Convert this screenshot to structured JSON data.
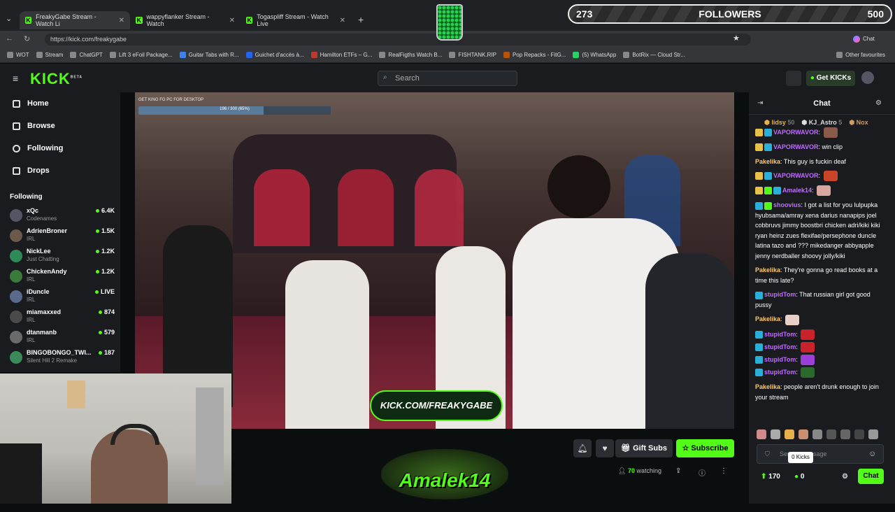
{
  "browser": {
    "tabs": [
      {
        "label": "FreakyGabe Stream - Watch Li"
      },
      {
        "label": "wappyflanker Stream - Watch"
      },
      {
        "label": "Togaspliff Stream - Watch Live"
      }
    ],
    "url": "https://kick.com/freakygabe",
    "bookmarks": [
      "WOT",
      "Stream",
      "ChatGPT",
      "Lift 3 eFoil Package...",
      "Guitar Tabs with R...",
      "Guichet d'accès à...",
      "Hamilton ETFs – G...",
      "RealFigths Watch B...",
      "FISHTANK.RIP",
      "Pop Repacks - FitG...",
      "(5) WhatsApp",
      "BotRix — Cloud Str...",
      "Other favourites"
    ],
    "profile_label": "Chat"
  },
  "overlay": {
    "followers_current": "273",
    "followers_label": "FOLLOWERS",
    "followers_goal": "500",
    "followers_progress": 0.546,
    "video_top_text": "GET KING FG PC FOR DESKTOP",
    "video_progress_text": "196 / 300 (65%)",
    "video_banner": "KICK.COM/FREAKYGABE",
    "logo_text": "Amalek14"
  },
  "kick": {
    "logo": "KICK",
    "beta": "BETA",
    "search_placeholder": "Search",
    "get_kicks": "Get KICKs",
    "nav": [
      {
        "label": "Home",
        "icon": "home-icon"
      },
      {
        "label": "Browse",
        "icon": "browse-icon"
      },
      {
        "label": "Following",
        "icon": "heart-icon"
      },
      {
        "label": "Drops",
        "icon": "drops-icon"
      }
    ],
    "following_heading": "Following",
    "following": [
      {
        "name": "xQc",
        "category": "Codenames",
        "viewers": "6.4K"
      },
      {
        "name": "AdrienBroner",
        "category": "IRL",
        "viewers": "1.5K"
      },
      {
        "name": "NickLee",
        "category": "Just Chatting",
        "viewers": "1.2K"
      },
      {
        "name": "ChickenAndy",
        "category": "IRL",
        "viewers": "1.2K"
      },
      {
        "name": "iDuncle",
        "category": "IRL",
        "viewers": "LIVE"
      },
      {
        "name": "miamaxxed",
        "category": "IRL",
        "viewers": "874"
      },
      {
        "name": "dtanmanb",
        "category": "IRL",
        "viewers": "579"
      },
      {
        "name": "BINGOBONGO_TWI...",
        "category": "Silent Hill 2 Remake",
        "viewers": "187"
      }
    ],
    "gift_subs": "Gift Subs",
    "subscribe": "Subscribe",
    "watching_count": "70",
    "watching_label": "watching"
  },
  "chat": {
    "title": "Chat",
    "gifters": [
      {
        "name": "lidsy",
        "count": "50"
      },
      {
        "name": "KJ_Astro",
        "count": "5"
      },
      {
        "name": "Nox",
        "count": ""
      }
    ],
    "messages": [
      {
        "user": "VAPORWAVOR",
        "color": "#c06cff",
        "text": ""
      },
      {
        "user": "VAPORWAVOR",
        "color": "#c06cff",
        "text": "win clip"
      },
      {
        "user": "Pakelika",
        "color": "#ffc76a",
        "text": "This guy is fuckin deaf"
      },
      {
        "user": "VAPORWAVOR",
        "color": "#c06cff",
        "text": ""
      },
      {
        "user": "Amalek14",
        "color": "#c06cff",
        "text": ""
      },
      {
        "user": "shoovius",
        "color": "#c06cff",
        "text": "I got a list for you lulpupka hyubsama/amray xena darius nanapips joel cobbruvs jimmy boostbri chicken adri/kiki kiki ryan heinz zues flexifae/persephone duncle latina tazo and ??? mikedanger abbyapple jenny nerdballer shoovy jolly/kiki"
      },
      {
        "user": "Pakelika",
        "color": "#ffc76a",
        "text": "They're gonna go read books at a time this late?"
      },
      {
        "user": "stupidTom",
        "color": "#c06cff",
        "text": "That russian girl got good pussy"
      },
      {
        "user": "Pakelika",
        "color": "#ffc76a",
        "text": ""
      },
      {
        "user": "stupidTom",
        "color": "#c06cff",
        "text": ""
      },
      {
        "user": "stupidTom",
        "color": "#c06cff",
        "text": ""
      },
      {
        "user": "stupidTom",
        "color": "#c06cff",
        "text": ""
      },
      {
        "user": "stupidTom",
        "color": "#c06cff",
        "text": ""
      },
      {
        "user": "Pakelika",
        "color": "#ffc76a",
        "text": "people aren't drunk enough to join your stream"
      }
    ],
    "input_placeholder": "Send a message",
    "tooltip": "0 Kicks",
    "points": "170",
    "kicks": "0",
    "send_button": "Chat"
  },
  "colors": {
    "accent": "#53fc18",
    "panel": "#191b1f",
    "background": "#0b0e0f"
  }
}
